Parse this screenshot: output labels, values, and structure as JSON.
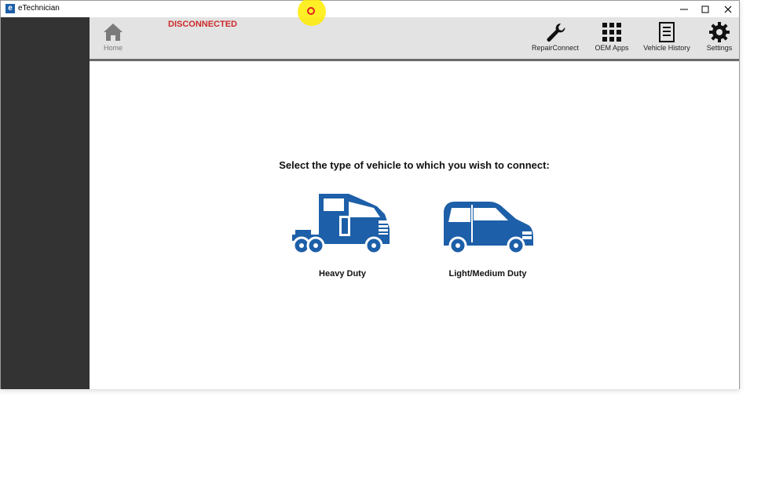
{
  "window": {
    "title": "eTechnician",
    "icon_letter": "e"
  },
  "status": {
    "text": "DISCONNECTED",
    "color": "#cc2a2a"
  },
  "toolbar": {
    "home_label": "Home",
    "items": [
      {
        "label": "RepairConnect",
        "icon": "wrench-icon"
      },
      {
        "label": "OEM Apps",
        "icon": "grid-icon"
      },
      {
        "label": "Vehicle History",
        "icon": "document-icon"
      },
      {
        "label": "Settings",
        "icon": "gear-icon"
      }
    ]
  },
  "main": {
    "prompt": "Select the type of vehicle to which you wish to connect:",
    "vehicles": [
      {
        "label": "Heavy Duty",
        "icon": "semi-truck-icon"
      },
      {
        "label": "Light/Medium Duty",
        "icon": "van-icon"
      }
    ]
  },
  "colors": {
    "accent": "#1d5fa8",
    "sidebar": "#333333",
    "toolbar": "#e3e3e3"
  }
}
